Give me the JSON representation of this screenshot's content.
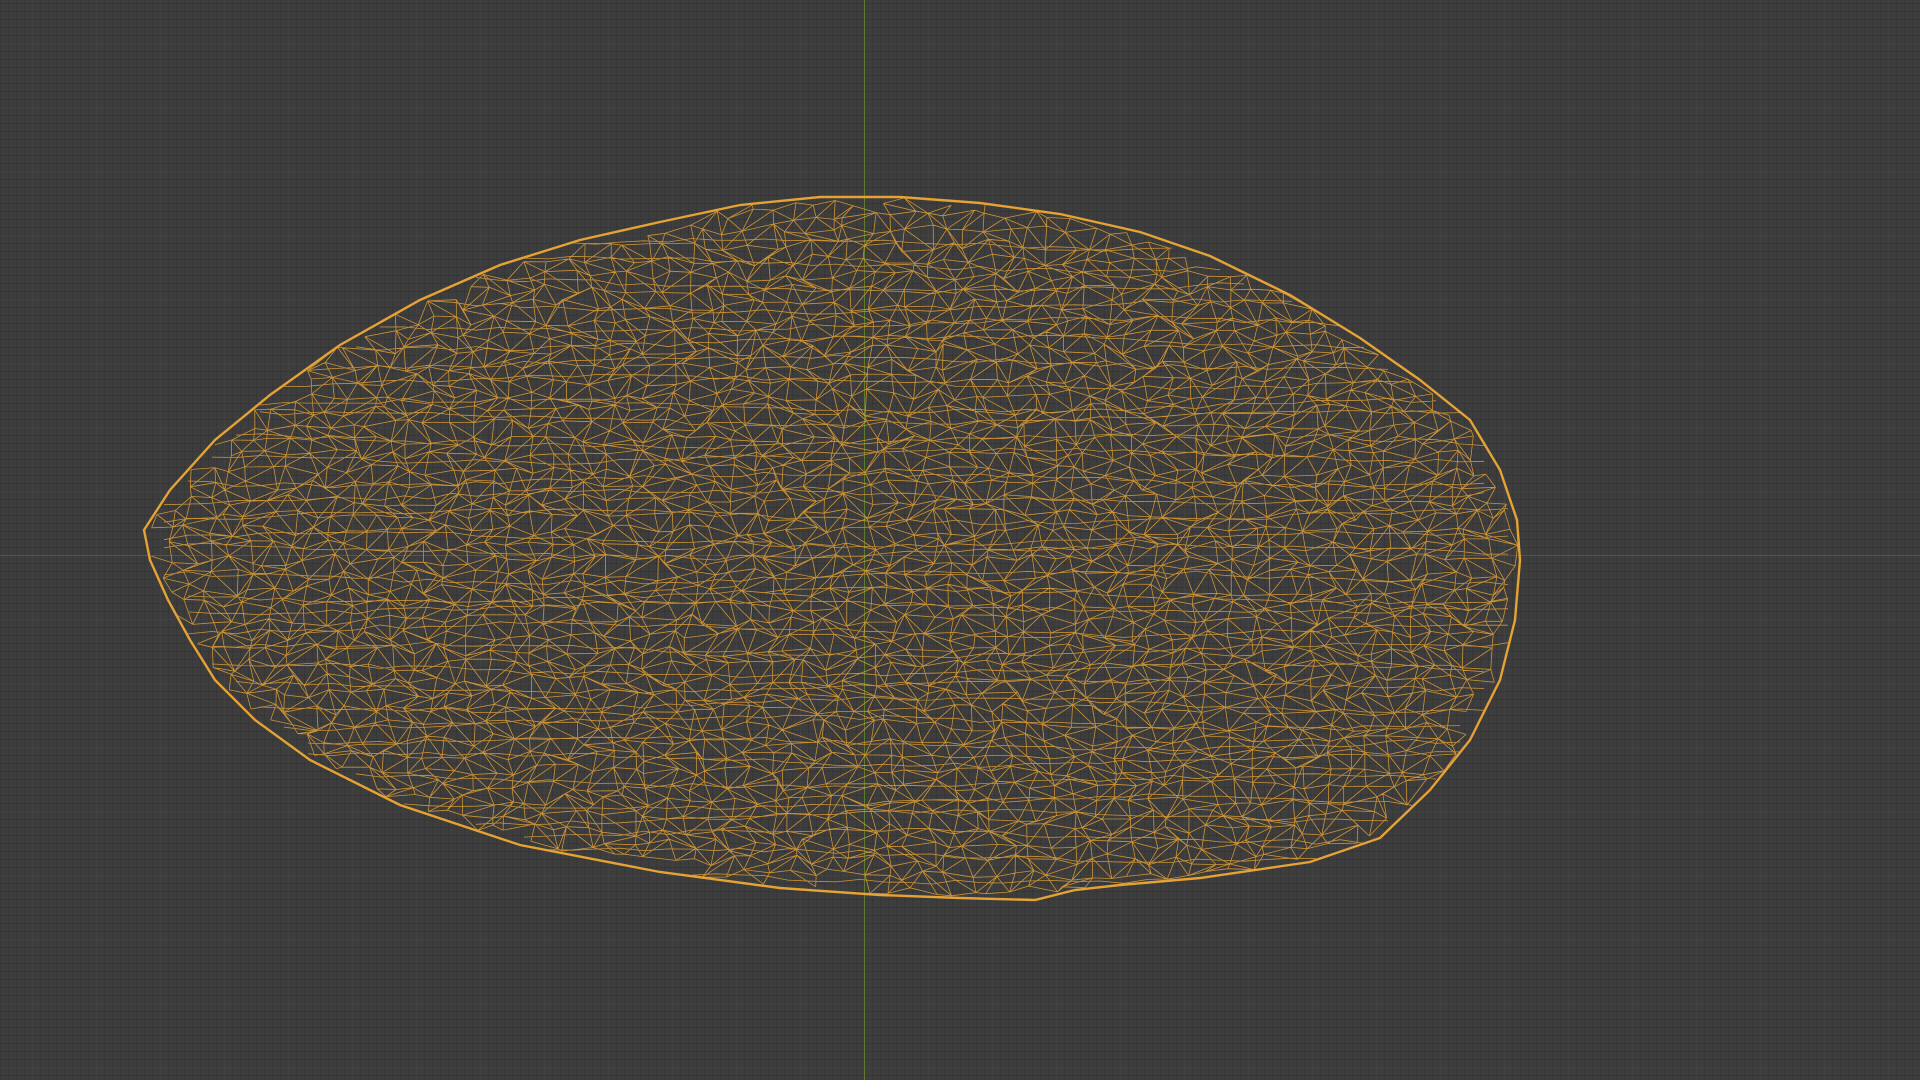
{
  "viewport": {
    "background": "#3d3d3d",
    "grid": "on"
  },
  "axes": {
    "x_axis_color": "#8c3a44",
    "y_axis_color": "#5d7a2e"
  },
  "object": {
    "display_mode": "wireframe",
    "selected": true,
    "wire_color": "#e5a235"
  }
}
